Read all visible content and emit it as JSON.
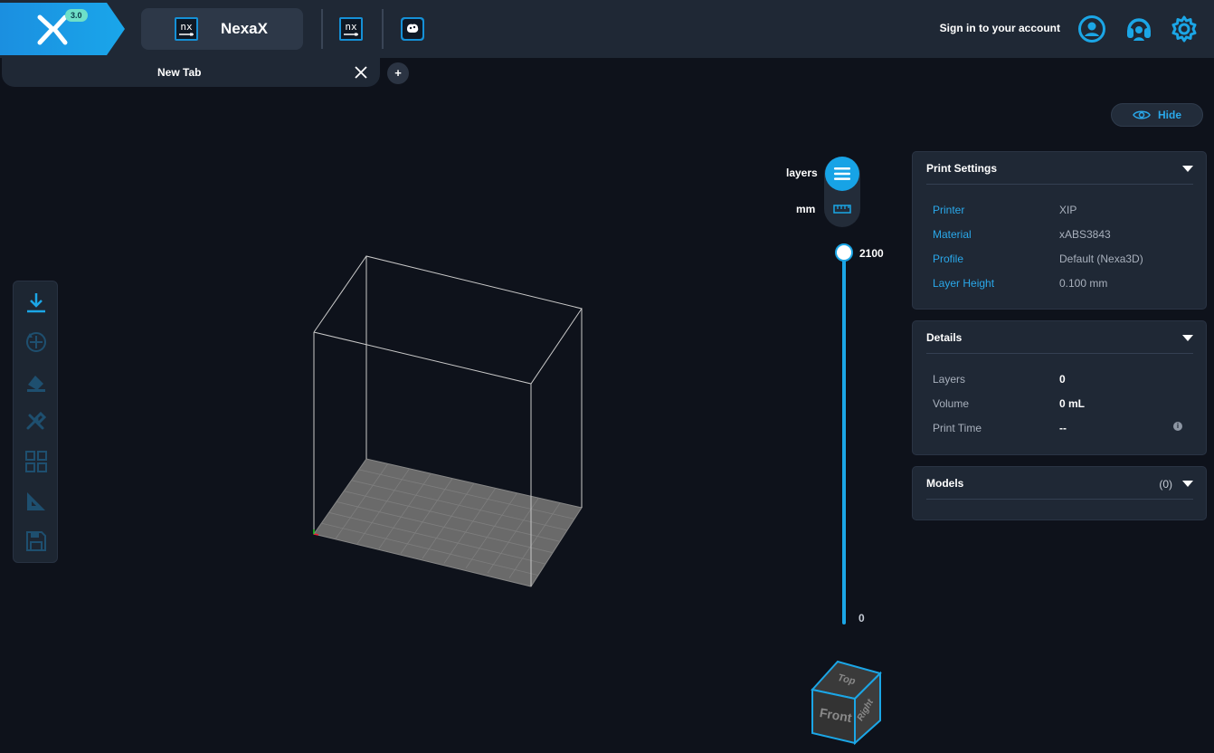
{
  "app": {
    "version": "3.0",
    "name": "NexaX",
    "brand_color": "#17a3e6"
  },
  "header": {
    "sign_in_label": "Sign in to your account",
    "icons": [
      "nx-app-icon",
      "brain-icon",
      "user-icon",
      "support-headset-icon",
      "settings-gear-icon"
    ]
  },
  "tabs": [
    {
      "label": "New Tab",
      "active": true
    }
  ],
  "add_tab_label": "+",
  "left_toolbar": {
    "tools": [
      "download-icon",
      "rotate-move-icon",
      "paint-icon",
      "tools-icon",
      "grid-arrange-icon",
      "measure-triangle-icon",
      "save-icon"
    ]
  },
  "layer_slider": {
    "unit_layers_label": "layers",
    "unit_mm_label": "mm",
    "active_unit": "layers",
    "max_label": "2100",
    "min_label": "0",
    "max": 2100,
    "min": 0,
    "value": 2100
  },
  "visibility_toggle": {
    "label": "Hide"
  },
  "print_settings": {
    "title": "Print Settings",
    "rows": [
      {
        "key": "Printer",
        "value": "XIP"
      },
      {
        "key": "Material",
        "value": "xABS3843"
      },
      {
        "key": "Profile",
        "value": "Default (Nexa3D)"
      },
      {
        "key": "Layer Height",
        "value": "0.100 mm"
      }
    ]
  },
  "details": {
    "title": "Details",
    "rows": [
      {
        "key": "Layers",
        "value": "0"
      },
      {
        "key": "Volume",
        "value": "0 mL"
      },
      {
        "key": "Print Time",
        "value": "--"
      }
    ],
    "info_glyph": "i"
  },
  "models": {
    "title": "Models",
    "count": "(0)"
  },
  "view_cube": {
    "top": "Top",
    "front": "Front",
    "right": "Right"
  }
}
